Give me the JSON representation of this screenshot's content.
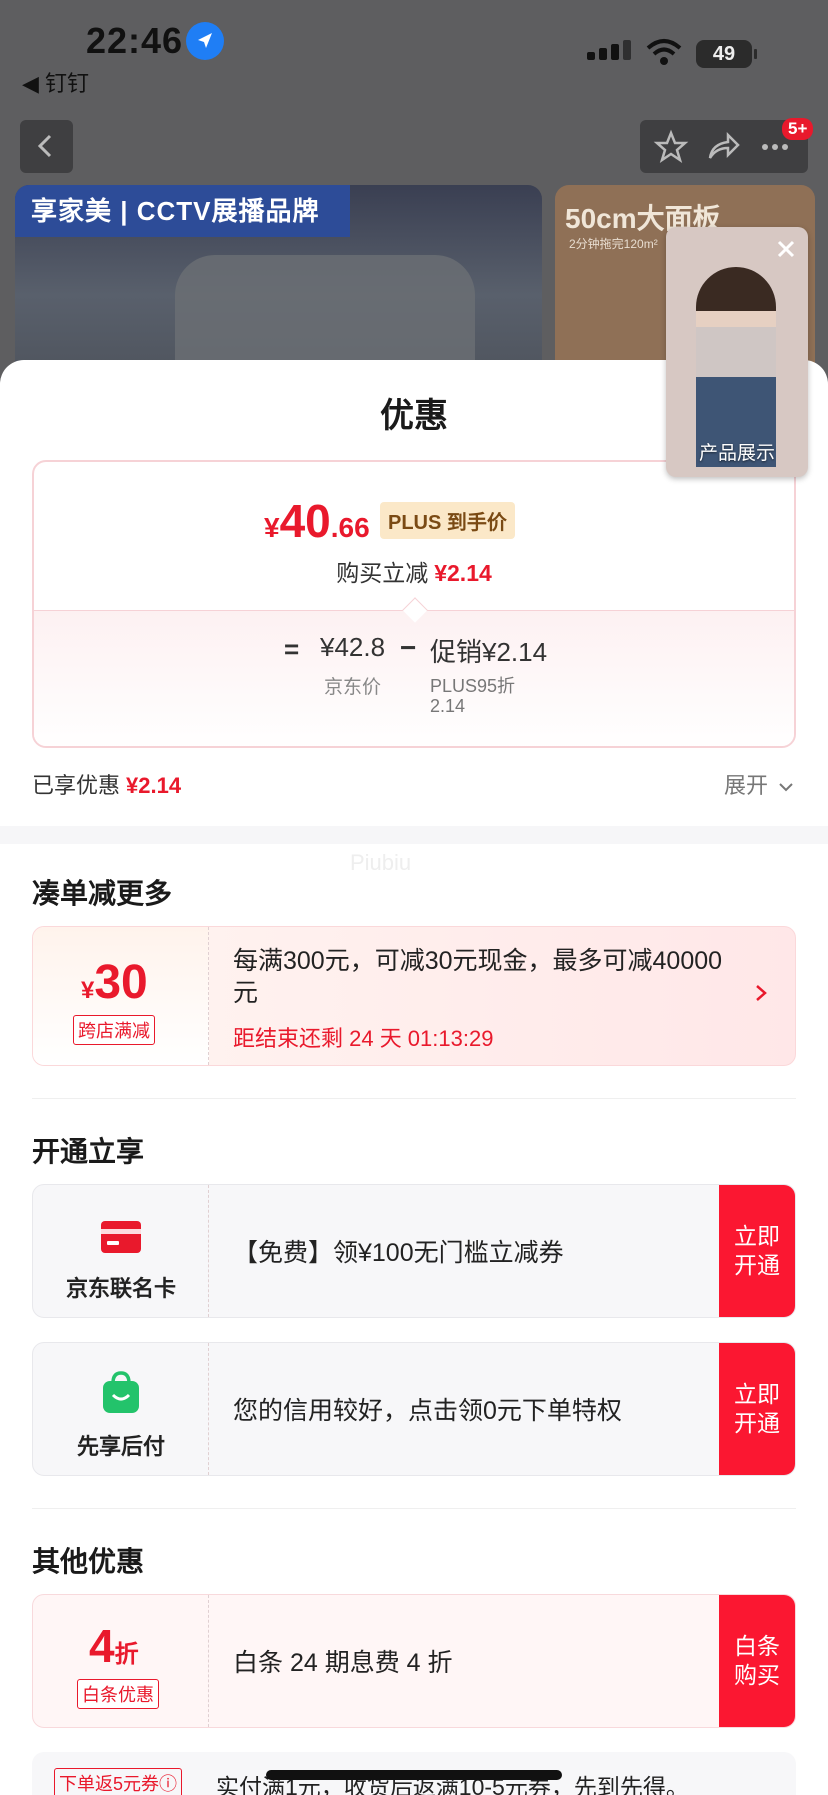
{
  "status_bar": {
    "time": "22:46",
    "back_app": "◀ 钉钉",
    "battery": "49"
  },
  "nav": {
    "badge": "5+"
  },
  "banners": {
    "left_brand": "享家美 | CCTV展播品牌",
    "right_title": "50cm大面板",
    "right_sub": "2分钟拖完120m²"
  },
  "video": {
    "caption": "产品展示"
  },
  "sheet": {
    "title": "优惠",
    "price": {
      "currency": "¥",
      "integer": "40",
      "decimal": ".66",
      "tag": "PLUS 到手价"
    },
    "reduce": {
      "label": "购买立减",
      "amount": "¥2.14"
    },
    "breakdown": {
      "eq": "=",
      "jd_price": "¥42.8",
      "minus": "−",
      "promo": "促销¥2.14",
      "jd_label": "京东价",
      "plus_label": "PLUS95折",
      "plus_value": "2.14"
    },
    "enjoyed": {
      "label": "已享优惠",
      "amount": "¥2.14"
    },
    "expand": "展开",
    "watermark": "Piubiu"
  },
  "section1": {
    "title": "凑单减更多",
    "coupon": {
      "currency": "¥",
      "value": "30",
      "tag": "跨店满减",
      "desc": "每满300元，可减30元现金，最多可减40000元",
      "countdown": "距结束还剩 24 天 01:13:29"
    }
  },
  "section2": {
    "title": "开通立享",
    "cards": [
      {
        "name": "京东联名卡",
        "desc": "【免费】领¥100无门槛立减券",
        "button": "立即开通",
        "icon": "credit-card-icon",
        "color": "#e9192c"
      },
      {
        "name": "先享后付",
        "desc": "您的信用较好，点击领0元下单特权",
        "button": "立即开通",
        "icon": "shopping-bag-icon",
        "color": "#23c36b"
      }
    ]
  },
  "section3": {
    "title": "其他优惠",
    "baitiao": {
      "value": "4",
      "unit": "折",
      "tag": "白条优惠",
      "desc": "白条 24 期息费 4 折",
      "button": "白条购买"
    },
    "next": {
      "tag": "下单返5元券ⓘ",
      "desc": "实付满1元，收货后返满10-5元券，先到先得。"
    }
  },
  "colors": {
    "accent": "#e9192c",
    "button_red": "#fb1731"
  }
}
